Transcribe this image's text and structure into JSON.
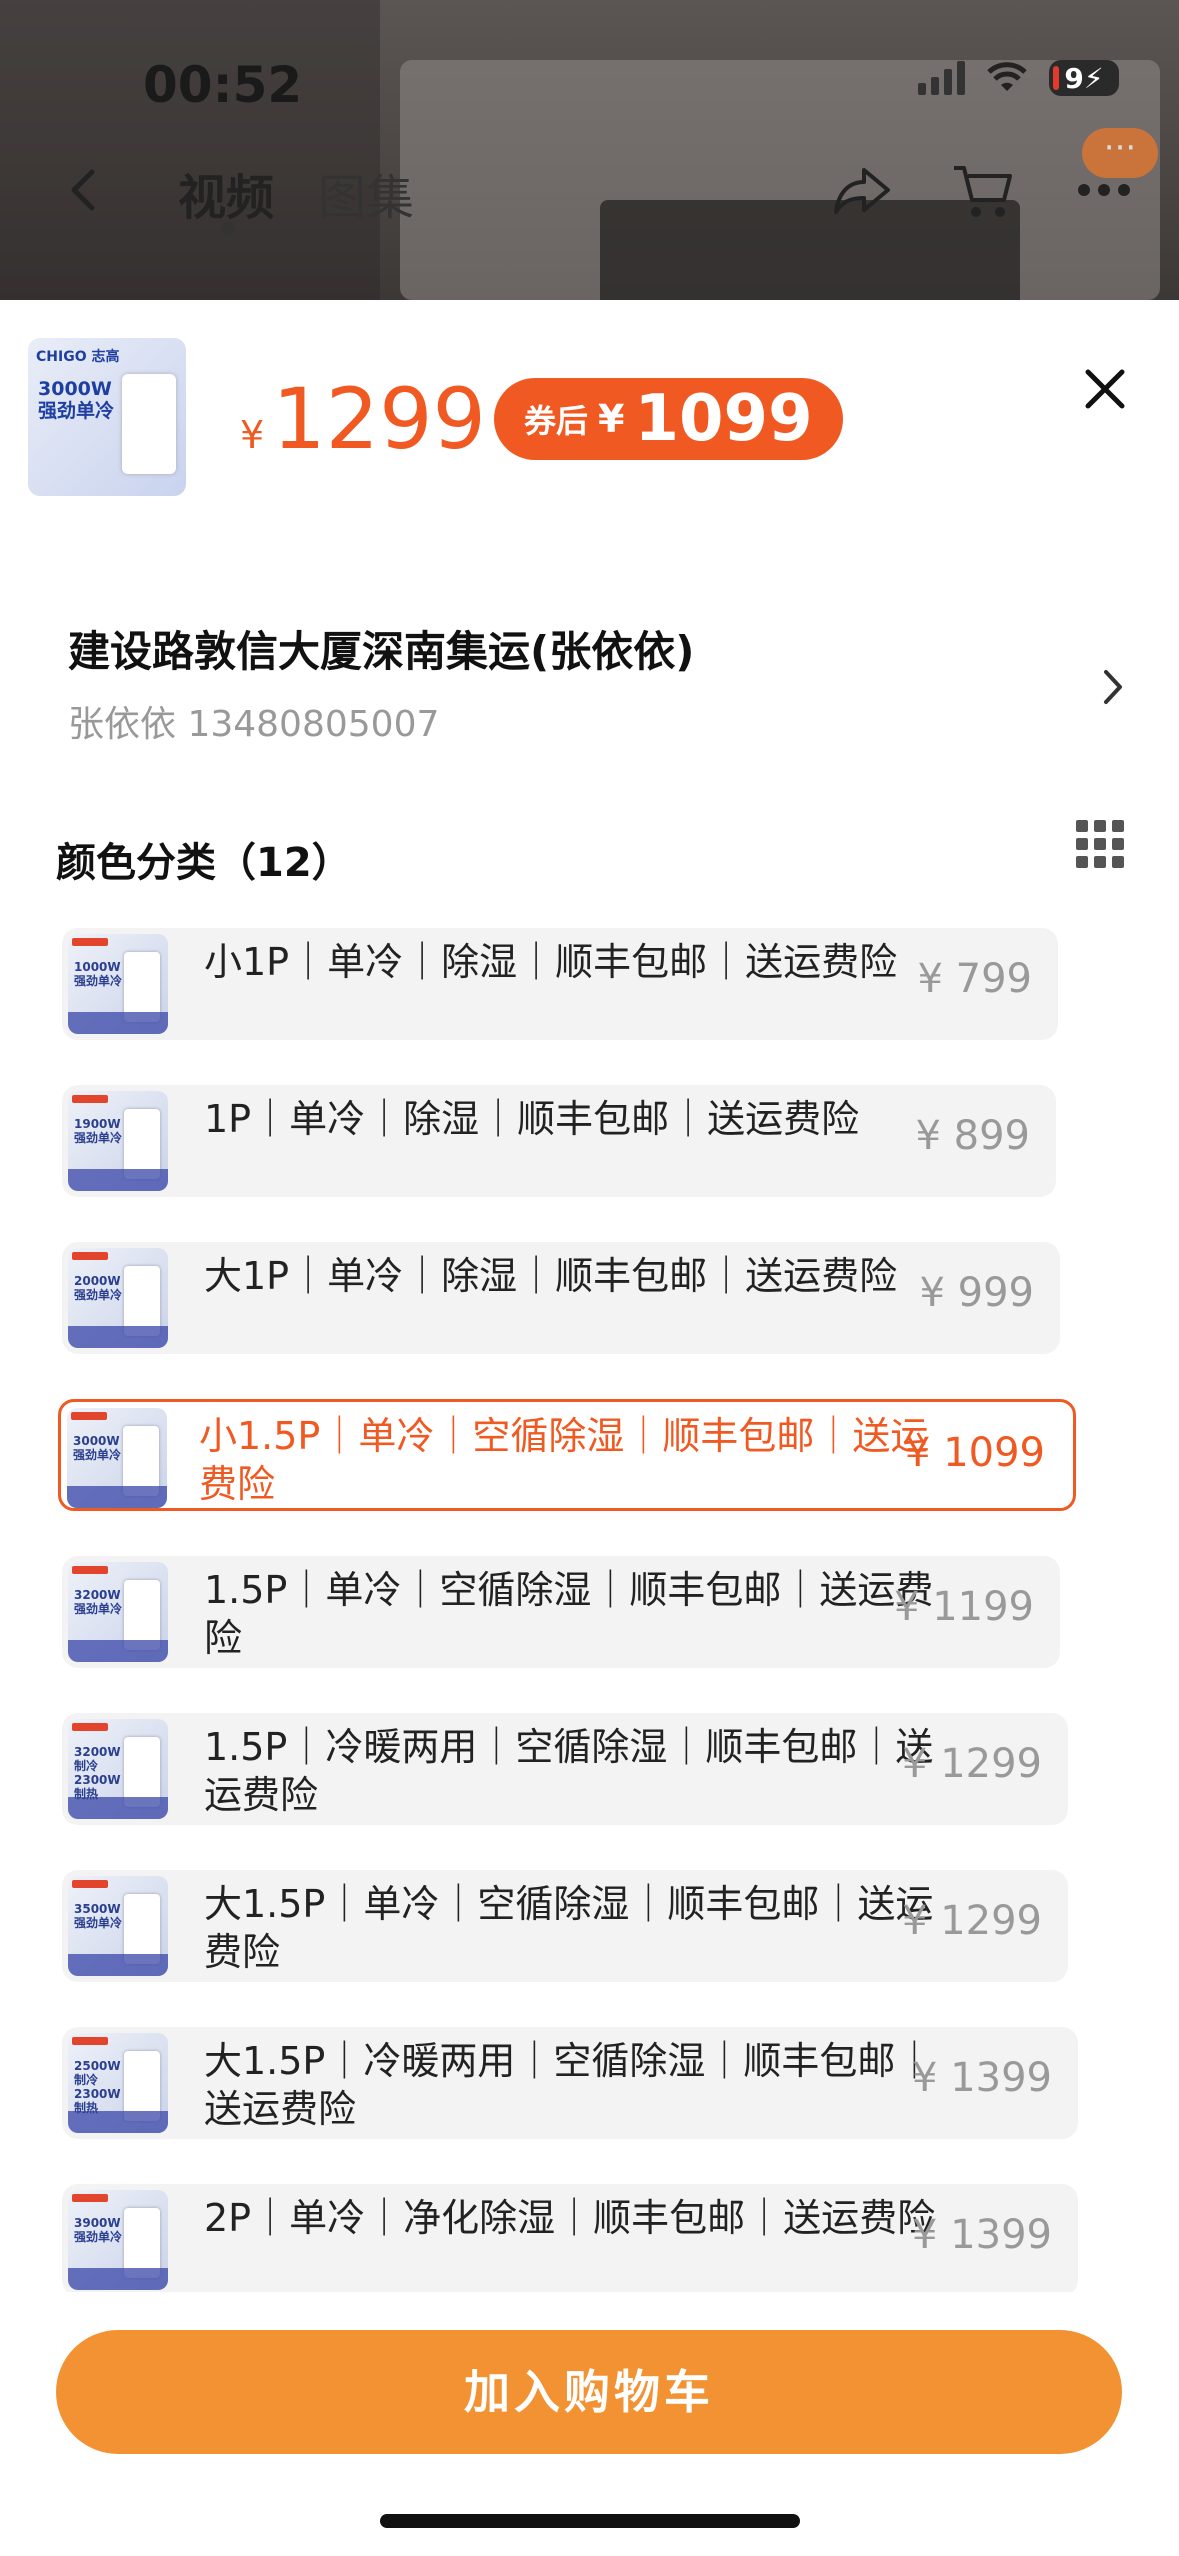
{
  "status": {
    "time": "00:52",
    "battery": "9"
  },
  "nav": {
    "tab_video": "视频",
    "tab_album": "图集",
    "bubble": "···"
  },
  "product": {
    "thumb_brand": "CHIGO 志高",
    "thumb_ad": "3000W\n强劲单冷",
    "price_yen": "¥",
    "price": "1299",
    "coupon_label": "券后",
    "coupon_yen": "¥",
    "coupon_price": "1099"
  },
  "address": {
    "line1": "建设路敦信大厦深南集运(张依依)",
    "line2": "张依依 13480805007"
  },
  "section": {
    "title": "颜色分类（12）"
  },
  "options": [
    {
      "label": "小1P｜单冷｜除湿｜顺丰包邮｜送运费险",
      "price": "¥ 799",
      "thumb": "1000W\n强劲单冷",
      "selected": false
    },
    {
      "label": "1P｜单冷｜除湿｜顺丰包邮｜送运费险",
      "price": "¥ 899",
      "thumb": "1900W\n强劲单冷",
      "selected": false
    },
    {
      "label": "大1P｜单冷｜除湿｜顺丰包邮｜送运费险",
      "price": "¥ 999",
      "thumb": "2000W\n强劲单冷",
      "selected": false
    },
    {
      "label": "小1.5P｜单冷｜空循除湿｜顺丰包邮｜送运费险",
      "price": "¥ 1099",
      "thumb": "3000W\n强劲单冷",
      "selected": true
    },
    {
      "label": "1.5P｜单冷｜空循除湿｜顺丰包邮｜送运费险",
      "price": "¥ 1199",
      "thumb": "3200W\n强劲单冷",
      "selected": false
    },
    {
      "label": "1.5P｜冷暖两用｜空循除湿｜顺丰包邮｜送运费险",
      "price": "¥ 1299",
      "thumb": "3200W制冷\n2300W制热",
      "selected": false
    },
    {
      "label": "大1.5P｜单冷｜空循除湿｜顺丰包邮｜送运费险",
      "price": "¥ 1299",
      "thumb": "3500W\n强劲单冷",
      "selected": false
    },
    {
      "label": "大1.5P｜冷暖两用｜空循除湿｜顺丰包邮｜送运费险",
      "price": "¥ 1399",
      "thumb": "2500W制冷\n2300W制热",
      "selected": false
    },
    {
      "label": "2P｜单冷｜净化除湿｜顺丰包邮｜送运费险",
      "price": "¥ 1399",
      "thumb": "3900W\n强劲单冷",
      "selected": false
    }
  ],
  "cta": {
    "label": "加入购物车"
  },
  "colors": {
    "accent": "#f05a22",
    "cta": "#f39233"
  }
}
